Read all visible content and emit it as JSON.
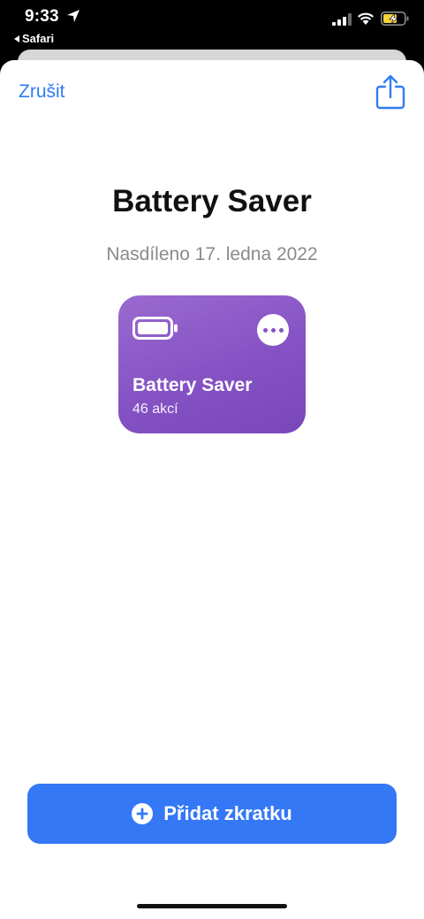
{
  "status_bar": {
    "time": "9:33",
    "back_app": "Safari",
    "icons": [
      "location-arrow-icon",
      "signal-icon",
      "wifi-icon",
      "battery-charging-icon"
    ]
  },
  "header": {
    "cancel_label": "Zrušit",
    "share_icon": "share-icon"
  },
  "shortcut": {
    "title": "Battery Saver",
    "shared_date": "Nasdíleno 17. ledna 2022",
    "card": {
      "name": "Battery Saver",
      "actions_count": "46 akcí",
      "icon": "battery-icon",
      "more_icon": "ellipsis-icon",
      "color": "#8552c4"
    }
  },
  "footer": {
    "add_label": "Přidat zkratku",
    "add_icon": "plus-circle-icon",
    "accent_color": "#3478f6"
  }
}
